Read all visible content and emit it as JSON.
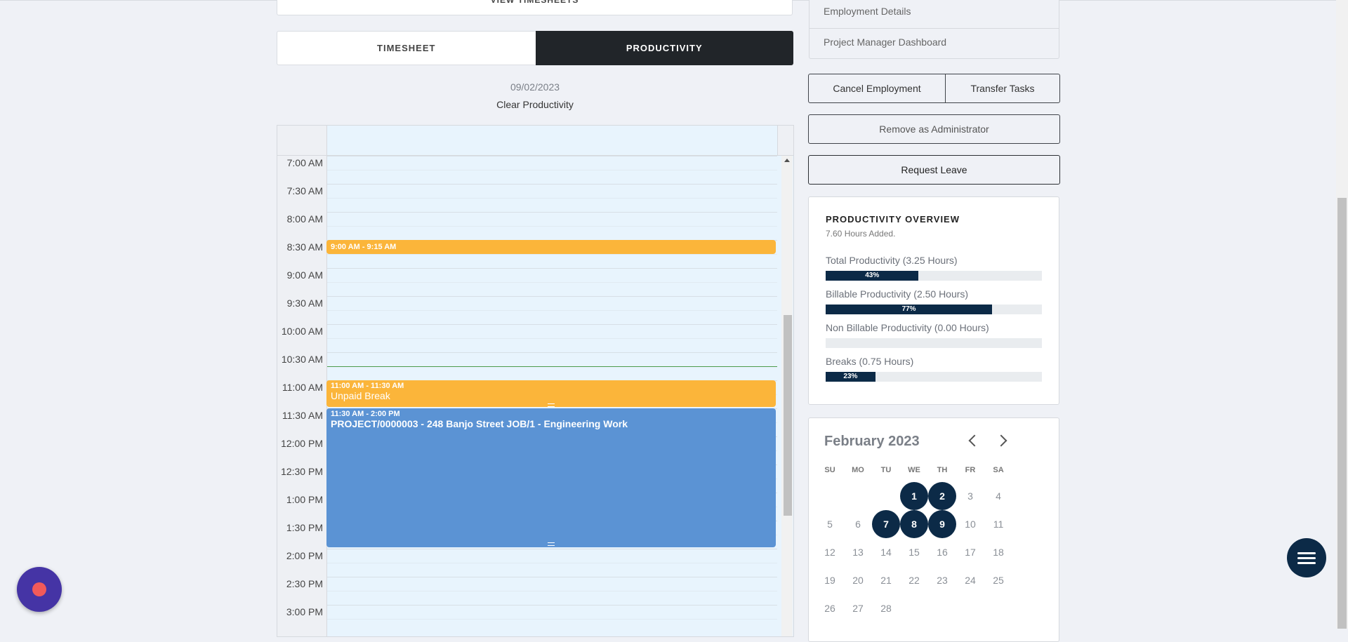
{
  "top": {
    "view_timesheets_label": "VIEW TIMESHEETS"
  },
  "tabs": [
    {
      "label": "TIMESHEET"
    },
    {
      "label": "PRODUCTIVITY"
    }
  ],
  "date": "09/02/2023",
  "clear_productivity_label": "Clear Productivity",
  "calendar": {
    "time_labels": [
      "7:00 AM",
      "7:30 AM",
      "8:00 AM",
      "8:30 AM",
      "9:00 AM",
      "9:30 AM",
      "10:00 AM",
      "10:30 AM",
      "11:00 AM",
      "11:30 AM",
      "12:00 PM",
      "12:30 PM",
      "1:00 PM",
      "1:30 PM",
      "2:00 PM",
      "2:30 PM",
      "3:00 PM"
    ],
    "events": [
      {
        "time": "9:00 AM - 9:15 AM",
        "title": ""
      },
      {
        "time": "11:00 AM - 11:30 AM",
        "title": "Unpaid Break"
      },
      {
        "time": "11:30 AM - 2:00 PM",
        "title": "PROJECT/0000003 - 248 Banjo Street JOB/1 - Engineering Work"
      }
    ]
  },
  "menu": {
    "employment_details": "Employment Details",
    "project_manager_dashboard": "Project Manager Dashboard"
  },
  "buttons": {
    "cancel_employment": "Cancel Employment",
    "transfer_tasks": "Transfer Tasks",
    "remove_admin": "Remove as Administrator",
    "request_leave": "Request Leave"
  },
  "productivity": {
    "title": "PRODUCTIVITY OVERVIEW",
    "subtitle": "7.60 Hours Added.",
    "bars": [
      {
        "label": "Total Productivity (3.25 Hours)",
        "percent": 43,
        "text": "43%"
      },
      {
        "label": "Billable Productivity (2.50 Hours)",
        "percent": 77,
        "text": "77%"
      },
      {
        "label": "Non Billable Productivity (0.00 Hours)",
        "percent": 0,
        "text": ""
      },
      {
        "label": "Breaks (0.75 Hours)",
        "percent": 23,
        "text": "23%"
      }
    ]
  },
  "mini_calendar": {
    "month": "February 2023",
    "dow": [
      "SU",
      "MO",
      "TU",
      "WE",
      "TH",
      "FR",
      "SA"
    ],
    "weeks": [
      [
        "",
        "",
        "",
        "1",
        "2",
        "3",
        "4"
      ],
      [
        "5",
        "6",
        "7",
        "8",
        "9",
        "10",
        "11"
      ],
      [
        "12",
        "13",
        "14",
        "15",
        "16",
        "17",
        "18"
      ],
      [
        "19",
        "20",
        "21",
        "22",
        "23",
        "24",
        "25"
      ],
      [
        "26",
        "27",
        "28",
        "",
        "",
        "",
        ""
      ]
    ],
    "selected": [
      "1",
      "2",
      "7",
      "8",
      "9"
    ]
  },
  "icons": {
    "fab_menu": "hamburger-icon",
    "record": "record-icon",
    "prev": "chevron-left-icon",
    "next": "chevron-right-icon"
  },
  "colors": {
    "primary_dark": "#0c2a47",
    "event_orange": "#fbb53a",
    "event_blue": "#5b93d4",
    "record_purple": "#4534a5",
    "record_red": "#f25a5a"
  }
}
